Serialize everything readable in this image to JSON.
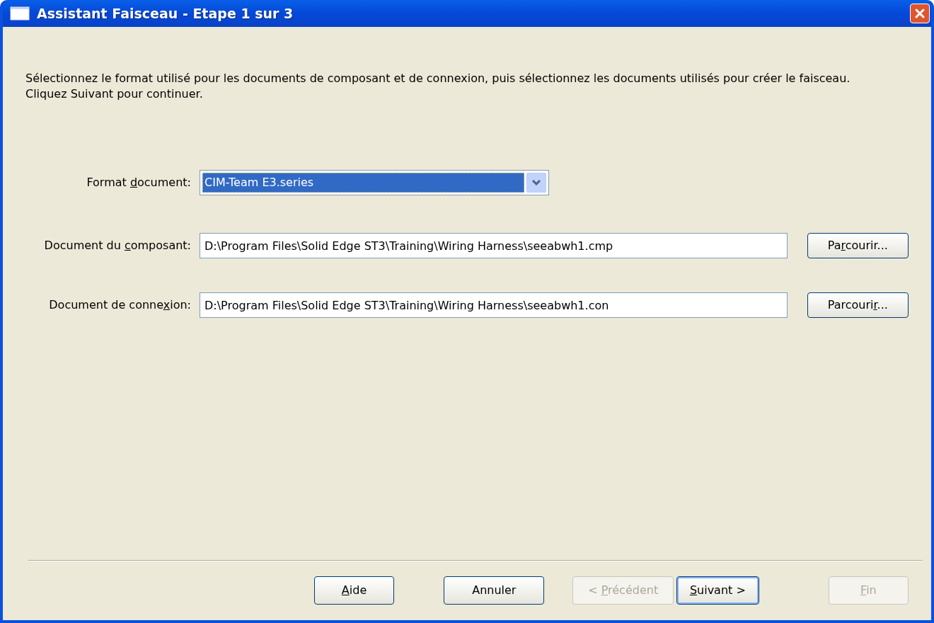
{
  "window": {
    "title": "Assistant Faisceau - Etape 1 sur 3"
  },
  "intro": "Sélectionnez le format utilisé pour les documents de composant et de connexion, puis sélectionnez les documents utilisés pour créer le faisceau. Cliquez Suivant pour continuer.",
  "format": {
    "label": {
      "pre": "Format ",
      "key": "d",
      "post": "ocument:"
    },
    "value": "CIM-Team E3.series",
    "focused": true
  },
  "documents": [
    {
      "label": {
        "pre": "Document du ",
        "key": "c",
        "post": "omposant:"
      },
      "value": "D:\\Program Files\\Solid Edge ST3\\Training\\Wiring Harness\\seeabwh1.cmp",
      "browse": {
        "pre": "Pa",
        "key": "r",
        "post": "courir..."
      }
    },
    {
      "label": {
        "pre": "Document de conne",
        "key": "x",
        "post": "ion:"
      },
      "value": "D:\\Program Files\\Solid Edge ST3\\Training\\Wiring Harness\\seeabwh1.con",
      "browse": {
        "pre": "Parcouri",
        "key": "r",
        "post": "..."
      }
    }
  ],
  "buttons": [
    {
      "label": {
        "key": "A",
        "post": "ide"
      },
      "disabled": false,
      "default": false
    },
    {
      "label": {
        "pre": "Annuler"
      },
      "disabled": false,
      "default": false
    },
    {
      "label": {
        "pre": "< ",
        "key": "P",
        "post": "récédent"
      },
      "disabled": true,
      "default": false
    },
    {
      "label": {
        "key": "S",
        "post": "uivant >"
      },
      "disabled": false,
      "default": true
    },
    {
      "label": {
        "key": "F",
        "post": "in"
      },
      "disabled": true,
      "default": false
    }
  ]
}
